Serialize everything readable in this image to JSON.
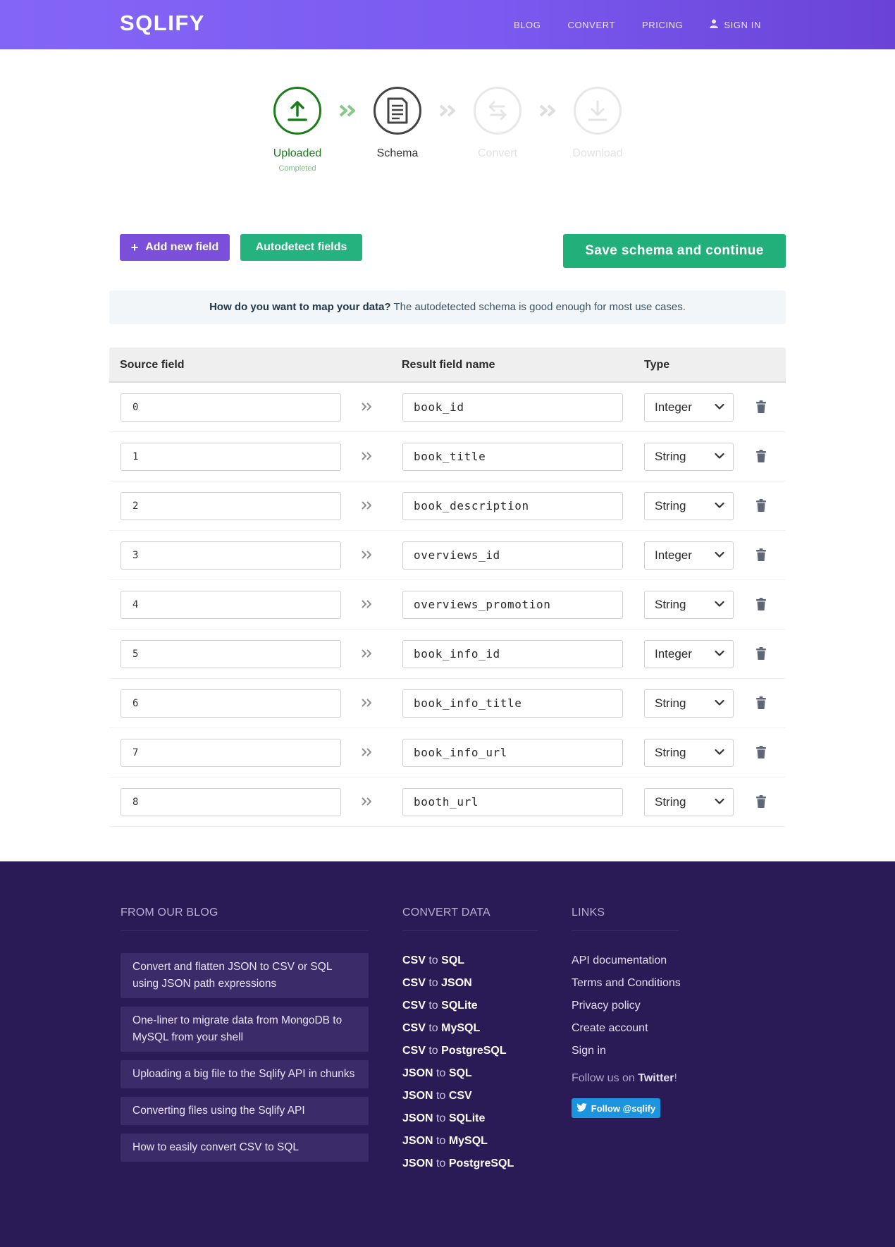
{
  "header": {
    "logo": "SQLIFY",
    "nav": [
      {
        "label": "BLOG"
      },
      {
        "label": "CONVERT"
      },
      {
        "label": "PRICING"
      },
      {
        "label": "SIGN IN"
      }
    ]
  },
  "steps": [
    {
      "label": "Uploaded",
      "sublabel": "Completed",
      "state": "done",
      "icon": "upload-icon"
    },
    {
      "label": "Schema",
      "sublabel": "",
      "state": "active",
      "icon": "document-icon"
    },
    {
      "label": "Convert",
      "sublabel": "",
      "state": "pending",
      "icon": "swap-icon"
    },
    {
      "label": "Download",
      "sublabel": "",
      "state": "pending",
      "icon": "download-icon"
    }
  ],
  "actions": {
    "add_field": "Add new field",
    "autodetect": "Autodetect fields",
    "save": "Save schema and continue"
  },
  "info": {
    "question": "How do you want to map your data?",
    "text": " The autodetected schema is good enough for most use cases."
  },
  "table": {
    "headers": {
      "source": "Source field",
      "result": "Result field name",
      "type": "Type"
    },
    "rows": [
      {
        "source": "0",
        "result": "book_id",
        "type": "Integer"
      },
      {
        "source": "1",
        "result": "book_title",
        "type": "String"
      },
      {
        "source": "2",
        "result": "book_description",
        "type": "String"
      },
      {
        "source": "3",
        "result": "overviews_id",
        "type": "Integer"
      },
      {
        "source": "4",
        "result": "overviews_promotion",
        "type": "String"
      },
      {
        "source": "5",
        "result": "book_info_id",
        "type": "Integer"
      },
      {
        "source": "6",
        "result": "book_info_title",
        "type": "String"
      },
      {
        "source": "7",
        "result": "book_info_url",
        "type": "String"
      },
      {
        "source": "8",
        "result": "booth_url",
        "type": "String"
      }
    ]
  },
  "footer": {
    "blog_title": "FROM OUR BLOG",
    "blog_items": [
      "Convert and flatten JSON to CSV or SQL using JSON path expressions",
      "One-liner to migrate data from MongoDB to MySQL from your shell",
      "Uploading a big file to the Sqlify API in chunks",
      "Converting files using the Sqlify API",
      "How to easily convert CSV to SQL"
    ],
    "convert_title": "CONVERT DATA",
    "convert_items": [
      {
        "from": "CSV",
        "to": "SQL"
      },
      {
        "from": "CSV",
        "to": "JSON"
      },
      {
        "from": "CSV",
        "to": "SQLite"
      },
      {
        "from": "CSV",
        "to": "MySQL"
      },
      {
        "from": "CSV",
        "to": "PostgreSQL"
      },
      {
        "from": "JSON",
        "to": "SQL"
      },
      {
        "from": "JSON",
        "to": "CSV"
      },
      {
        "from": "JSON",
        "to": "SQLite"
      },
      {
        "from": "JSON",
        "to": "MySQL"
      },
      {
        "from": "JSON",
        "to": "PostgreSQL"
      }
    ],
    "convert_joiner": " to ",
    "links_title": "LINKS",
    "links": [
      "API documentation",
      "Terms and Conditions",
      "Privacy policy",
      "Create account",
      "Sign in"
    ],
    "follow_prefix": "Follow us on ",
    "follow_link": "Twitter",
    "follow_suffix": "!",
    "twitter_button": "Follow @sqlify"
  },
  "colors": {
    "header_start": "#8466f7",
    "header_end": "#6a42d6",
    "done_green": "#1a7e1a",
    "add_button": "#7b4fd9",
    "save_button": "#22b07a",
    "footer_bg": "#2a1a55",
    "twitter_blue": "#1b95e0"
  }
}
